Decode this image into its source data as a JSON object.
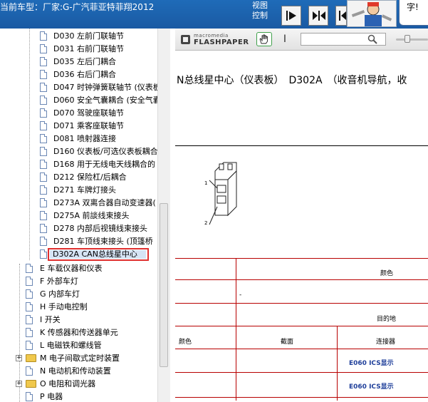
{
  "header": {
    "vehicle_title": "当前车型：厂家:G-广汽菲亚特菲翔2012",
    "view_control_line1": "视图",
    "view_control_line2": "控制",
    "tooltip_line1": "字!",
    "tooltip_line2": ""
  },
  "tree": {
    "items": [
      {
        "label": "D030 左前门联轴节"
      },
      {
        "label": "D031 右前门联轴节"
      },
      {
        "label": "D035 左后门耦合"
      },
      {
        "label": "D036 右后门耦合"
      },
      {
        "label": "D047 时钟弹簧联轴节 (仪表板"
      },
      {
        "label": "D060 安全气囊耦合 (安全气囊"
      },
      {
        "label": "D070 驾驶座联轴节"
      },
      {
        "label": "D071 乘客座联轴节"
      },
      {
        "label": "D081 喷射器连接"
      },
      {
        "label": "D160 仪表板/可选仪表板耦合"
      },
      {
        "label": "D168 用于无线电天线耦合的"
      },
      {
        "label": "D212 保险杠/后耦合"
      },
      {
        "label": "D271 车牌灯接头"
      },
      {
        "label": "D273A 双离合器自动变速器("
      },
      {
        "label": "D275A 前談线束接头"
      },
      {
        "label": "D278 内部后视镜线束接头"
      },
      {
        "label": "D281 车顶线束接头 (顶篷桥"
      },
      {
        "label": "D302A CAN总线星中心"
      }
    ],
    "groups": [
      {
        "label": "E 车载仪器和仪表",
        "type": "doc"
      },
      {
        "label": "F 外部车灯",
        "type": "doc"
      },
      {
        "label": "G 内部车灯",
        "type": "doc"
      },
      {
        "label": "H 手动电控制",
        "type": "doc"
      },
      {
        "label": "I 开关",
        "type": "doc"
      },
      {
        "label": "K 传感器和传送器单元",
        "type": "doc"
      },
      {
        "label": "L 电磁铁和螺线管",
        "type": "doc"
      },
      {
        "label": "M 电子间歇式定时装置",
        "type": "folder"
      },
      {
        "label": "N 电动机和传动装置",
        "type": "doc"
      },
      {
        "label": "O 电阻和调光器",
        "type": "folder"
      },
      {
        "label": "P 电器",
        "type": "doc"
      }
    ],
    "selected_index": 17
  },
  "viewer": {
    "brand_small": "macromedia",
    "brand_product": "FLASHPAPER",
    "text_tool_glyph": "I",
    "search_value": "",
    "heading": "N总线星中心（仪表板）　D302A　（收音机导航，收",
    "pin_labels": [
      "1",
      "2"
    ]
  },
  "table": {
    "row_color_header": "颜色",
    "row_dash": "-",
    "row_destination": "目的地",
    "col_color": "颜色",
    "col_section": "截面",
    "col_connector": "连接器",
    "link_1": "E060 ICS显示",
    "link_2": "E060 ICS显示"
  },
  "colors": {
    "header_bg": "#1f6bb8",
    "selection_border": "#e0302f",
    "table_lines": "#b80000",
    "link": "#1f3f9a"
  }
}
